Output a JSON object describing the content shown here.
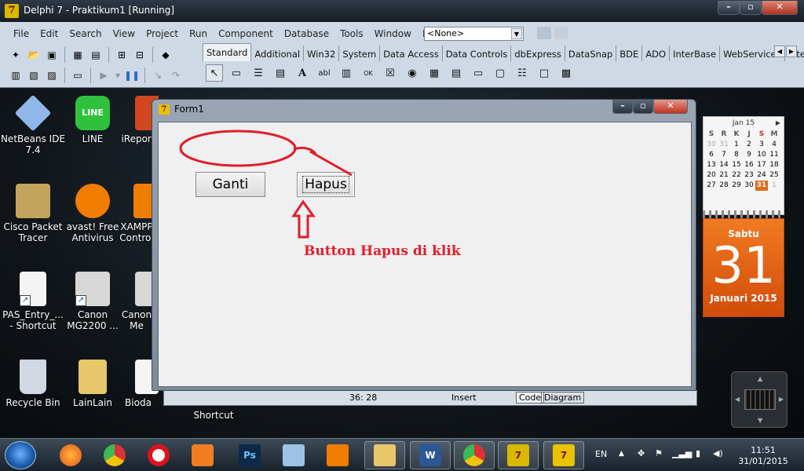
{
  "ide": {
    "title": "Delphi 7 - Praktikum1 [Running]",
    "logo": "7",
    "menu": [
      "File",
      "Edit",
      "Search",
      "View",
      "Project",
      "Run",
      "Component",
      "Database",
      "Tools",
      "Window",
      "Help"
    ],
    "component_selector": "<None>",
    "palette_tabs": [
      "Standard",
      "Additional",
      "Win32",
      "System",
      "Data Access",
      "Data Controls",
      "dbExpress",
      "DataSnap",
      "BDE",
      "ADO",
      "InterBase",
      "WebServices",
      "Intern"
    ],
    "active_tab": "Standard",
    "palette_icons": [
      "pointer-icon",
      "frames-icon",
      "main-menu-icon",
      "popup-menu-icon",
      "label-icon",
      "edit-icon",
      "memo-icon",
      "button-icon",
      "checkbox-icon",
      "radiobutton-icon",
      "listbox-icon",
      "combobox-icon",
      "scrollbar-icon",
      "groupbox-icon",
      "radiogroup-icon",
      "panel-icon",
      "actionlist-icon"
    ]
  },
  "desktop_icons": [
    {
      "label": "NetBeans IDE 7.4",
      "icon": "netbeans-icon",
      "color": "#8fb8e8"
    },
    {
      "label": "LINE",
      "icon": "line-icon",
      "color": "#2fc13b"
    },
    {
      "label": "iReport",
      "icon": "ireport-icon",
      "color": "#d0461e"
    },
    {
      "label": "Cisco Packet Tracer",
      "icon": "cisco-icon",
      "color": "#c2a45a"
    },
    {
      "label": "avast! Free Antivirus",
      "icon": "avast-icon",
      "color": "#f07d00"
    },
    {
      "label": "XAMPP Control",
      "icon": "xampp-icon",
      "color": "#f07d00"
    },
    {
      "label": "PAS_Entry_... - Shortcut",
      "icon": "java-file-icon",
      "color": "#f4f4f4"
    },
    {
      "label": "Canon MG2200 ...",
      "icon": "canon-icon",
      "color": "#d8d8d8"
    },
    {
      "label": "Canon Me",
      "icon": "canon2-icon",
      "color": "#d8d8d8"
    },
    {
      "label": "Recycle Bin",
      "icon": "recycle-bin-icon",
      "color": "#cfd8e3"
    },
    {
      "label": "LainLain",
      "icon": "folder-icon",
      "color": "#e8c76a"
    },
    {
      "label": "Bioda",
      "icon": "doc-icon",
      "color": "#f4f4f4"
    }
  ],
  "calendar": {
    "month": "Jan 15",
    "headers": [
      "S",
      "R",
      "K",
      "J",
      "S",
      "M"
    ],
    "rows": [
      [
        "30",
        "31",
        "1",
        "2",
        "3",
        "4"
      ],
      [
        "6",
        "7",
        "8",
        "9",
        "10",
        "11"
      ],
      [
        "13",
        "14",
        "15",
        "16",
        "17",
        "18"
      ],
      [
        "20",
        "21",
        "22",
        "23",
        "24",
        "25"
      ],
      [
        "27",
        "28",
        "29",
        "30",
        "31",
        "1"
      ]
    ],
    "day_name": "Sabtu",
    "day_number": "31",
    "month_year": "Januari 2015"
  },
  "form": {
    "title": "Form1",
    "ganti_label": "Ganti",
    "hapus_label": "Hapus",
    "annotation": "Button Hapus di klik"
  },
  "statusbar": {
    "position": "36: 28",
    "mode": "Insert",
    "tabs": [
      "Code",
      "Diagram"
    ],
    "shortcut_label": "Shortcut"
  },
  "taskbar": {
    "apps": [
      "firefox-icon",
      "chrome-icon",
      "opera-icon",
      "media-player-icon",
      "photoshop-icon",
      "virtualbox-icon",
      "xampp-icon",
      "file-explorer-icon",
      "word-icon",
      "chrome-icon",
      "delphi-icon",
      "delphi7-icon"
    ],
    "language": "EN",
    "time": "11:51",
    "date": "31/01/2015"
  },
  "colors": {
    "annotation_red": "#e11d2a",
    "calendar_orange": "#e06a1c"
  }
}
